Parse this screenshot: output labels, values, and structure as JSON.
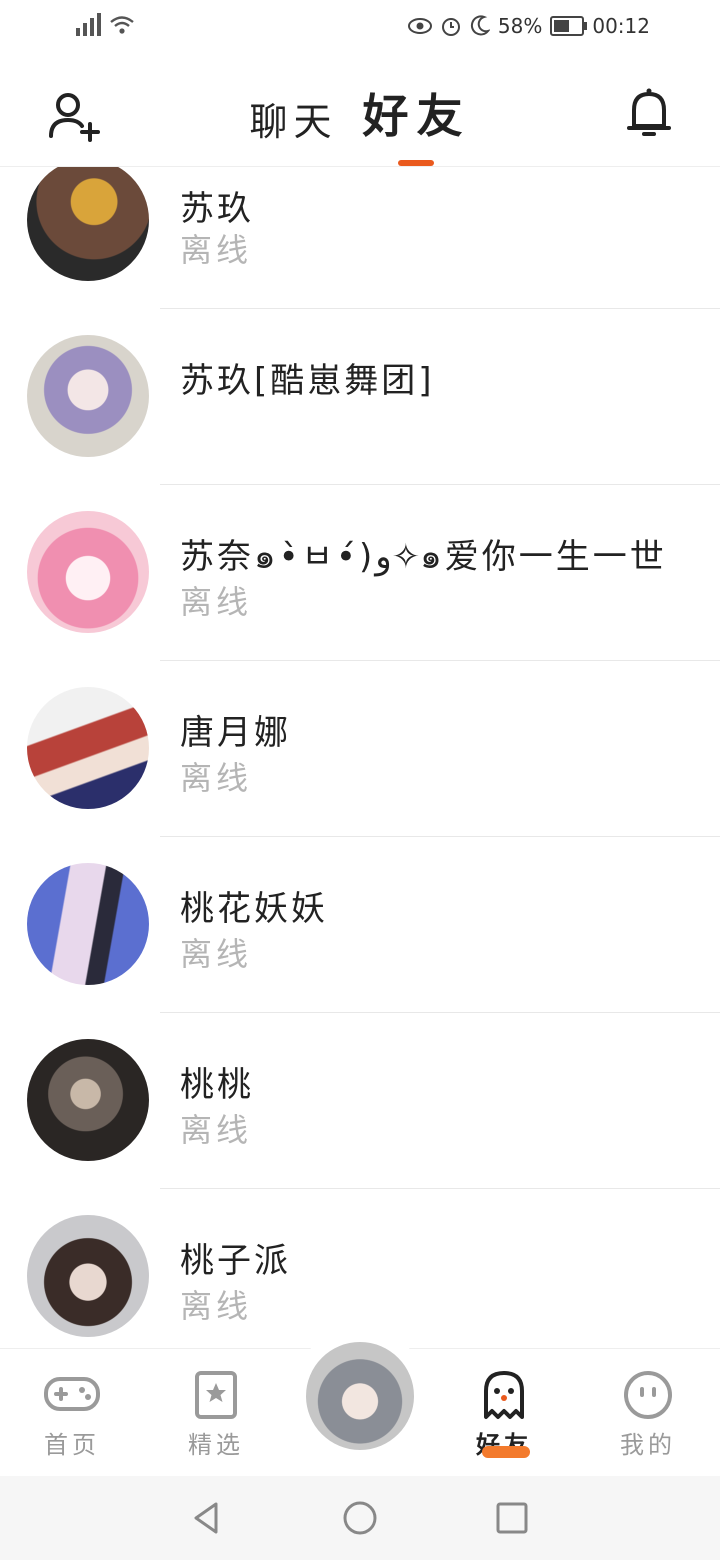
{
  "status_bar": {
    "battery": "58%",
    "time": "00:12",
    "network": "G"
  },
  "header": {
    "tab_chat": "聊天",
    "tab_friends": "好友",
    "active_tab": "friends"
  },
  "friends": [
    {
      "name": "苏玖",
      "status": "离线",
      "avatar_colors": [
        "#6b4a3a",
        "#d9a43a",
        "#2a2a2a"
      ]
    },
    {
      "name": "苏玖[酷崽舞团]",
      "status": "",
      "avatar_colors": [
        "#d8d4cc",
        "#9b8fc0",
        "#f3e6e6"
      ]
    },
    {
      "name": "苏奈๑•̀ㅂ•́)و✧๑爱你一生一世",
      "status": "离线",
      "avatar_colors": [
        "#f7c9d6",
        "#f08fb0",
        "#fff0f4"
      ]
    },
    {
      "name": "唐月娜",
      "status": "离线",
      "avatar_colors": [
        "#f1f1f1",
        "#b8423a",
        "#2b2f6b"
      ]
    },
    {
      "name": "桃花妖妖",
      "status": "离线",
      "avatar_colors": [
        "#5b6fd0",
        "#e8d8ec",
        "#2a2a3a"
      ]
    },
    {
      "name": "桃桃",
      "status": "离线",
      "avatar_colors": [
        "#2a2624",
        "#6a5f58",
        "#c8b8a8"
      ]
    },
    {
      "name": "桃子派",
      "status": "离线",
      "avatar_colors": [
        "#c9c9cc",
        "#3a2c28",
        "#e8d8d0"
      ]
    }
  ],
  "bottom_nav": {
    "home": "首页",
    "featured": "精选",
    "friends": "好友",
    "mine": "我的",
    "active": "friends"
  },
  "colors": {
    "accent": "#ea5a1e",
    "accent_light": "#f37a2c",
    "muted_text": "#b5b5b5"
  }
}
